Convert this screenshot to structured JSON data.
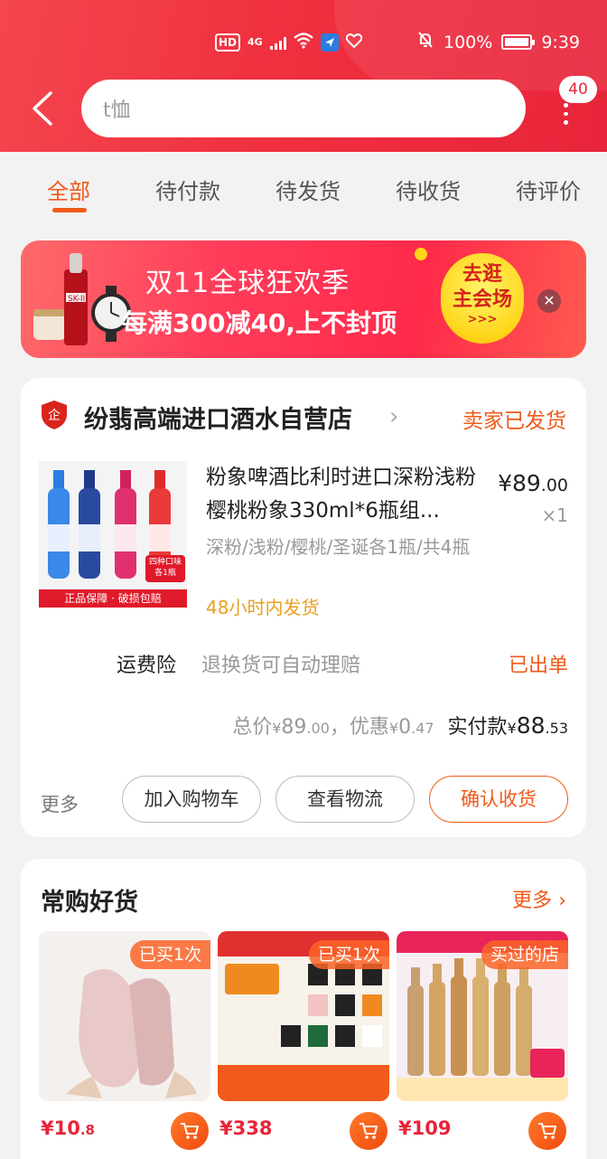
{
  "status_bar": {
    "network": "HD",
    "signal": "4G",
    "battery": "100%",
    "time": "9:39"
  },
  "search": {
    "value": "t恤"
  },
  "more_badge": "40",
  "tabs": [
    {
      "label": "全部",
      "active": true
    },
    {
      "label": "待付款",
      "active": false
    },
    {
      "label": "待发货",
      "active": false
    },
    {
      "label": "待收货",
      "active": false
    },
    {
      "label": "待评价",
      "active": false
    }
  ],
  "banner": {
    "title": "双11全球狂欢季",
    "subtitle": "每满300减40,上不封顶",
    "cta_line1": "去逛",
    "cta_line2": "主会场",
    "cta_arrows": ">>>",
    "product_brand": "SK-II"
  },
  "order": {
    "shop_name": "纷翡高端进口酒水自营店",
    "status": "卖家已发货",
    "item": {
      "title": "粉象啤酒比利时进口深粉浅粉樱桃粉象330ml*6瓶组...",
      "price_int": "¥89",
      "price_dec": ".00",
      "quantity": "×1",
      "spec": "深粉/浅粉/樱桃/圣诞各1瓶/共4瓶",
      "shipping": "48小时内发货",
      "thumb_strip": "正品保障 · 破损包赔",
      "thumb_tag": "四种口味各1瓶"
    },
    "insurance": {
      "label": "运费险",
      "desc": "退换货可自动理赔",
      "status": "已出单"
    },
    "totals": {
      "total_label": "总价",
      "total_int": "89",
      "total_dec": ".00",
      "discount_label": "，优惠",
      "discount_int": "0",
      "discount_dec": ".47",
      "paid_label": "实付款",
      "paid_int": "88",
      "paid_dec": ".53",
      "currency": "¥"
    },
    "actions": {
      "more": "更多",
      "add_cart": "加入购物车",
      "logistics": "查看物流",
      "confirm": "确认收货"
    }
  },
  "frequent": {
    "title": "常购好货",
    "more": "更多",
    "items": [
      {
        "badge": "已买1次",
        "price_int": "¥10",
        "price_dec": ".8"
      },
      {
        "badge": "已买1次",
        "price_int": "¥338",
        "price_dec": ""
      },
      {
        "badge": "买过的店",
        "price_int": "¥109",
        "price_dec": ""
      }
    ]
  },
  "colors": {
    "header_red": "#f0303f",
    "accent_orange": "#f05a1a",
    "price_red": "#e8243a",
    "shipping_amber": "#e8a020"
  }
}
